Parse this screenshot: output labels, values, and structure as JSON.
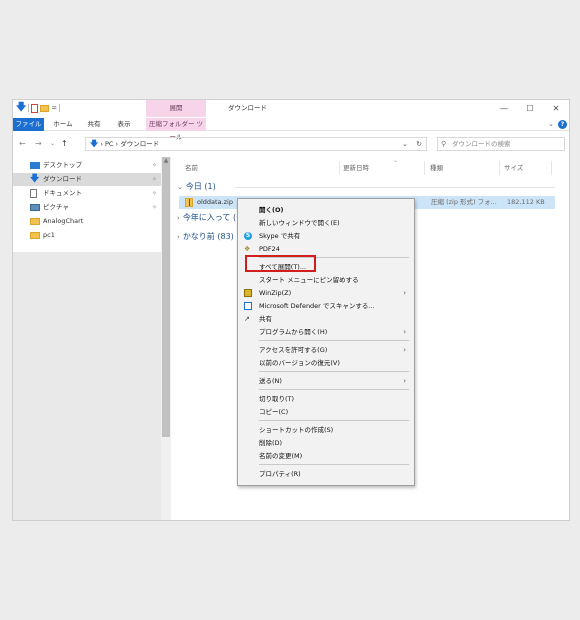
{
  "titlebar": {
    "context_tab_title": "展開",
    "window_title": "ダウンロード",
    "qa_eq": "=",
    "minimize": "—",
    "maximize": "☐",
    "close": "✕"
  },
  "ribbon": {
    "tabs": [
      "ファイル",
      "ホーム",
      "共有",
      "表示",
      "圧縮フォルダー ツール"
    ],
    "help": "?"
  },
  "address": {
    "path_pc": "PC",
    "path_sep": "›",
    "path_folder": "ダウンロード",
    "search_placeholder": "ダウンロードの検索"
  },
  "nav_pane": {
    "items": [
      {
        "label": "デスクトップ",
        "icon": "desktop-icon",
        "pinned": true
      },
      {
        "label": "ダウンロード",
        "icon": "download-icon",
        "pinned": true,
        "selected": true
      },
      {
        "label": "ドキュメント",
        "icon": "document-icon",
        "pinned": true
      },
      {
        "label": "ピクチャ",
        "icon": "picture-icon",
        "pinned": true
      },
      {
        "label": "AnalogChart",
        "icon": "folder-icon",
        "pinned": false
      },
      {
        "label": "pc1",
        "icon": "folder-icon",
        "pinned": false
      }
    ]
  },
  "columns": {
    "name": "名前",
    "modified": "更新日時",
    "type": "種類",
    "size": "サイズ"
  },
  "groups": {
    "today": "今日 (1)",
    "this_year": "今年に入って (",
    "long_ago": "かなり前 (83)"
  },
  "file": {
    "name": "olddata.zip",
    "type": "圧縮 (zip 形式) フォ...",
    "size": "182,112 KB"
  },
  "context_menu": {
    "open": "開く(O)",
    "open_new_window": "新しいウィンドウで開く(E)",
    "skype_share": "Skype で共有",
    "pdf24": "PDF24",
    "extract_all": "すべて展開(T)...",
    "pin_start": "スタート メニューにピン留めする",
    "winzip": "WinZip(Z)",
    "defender": "Microsoft Defender でスキャンする...",
    "share": "共有",
    "open_with": "プログラムから開く(H)",
    "give_access": "アクセスを許可する(G)",
    "restore_prev": "以前のバージョンの復元(V)",
    "send_to": "送る(N)",
    "cut": "切り取り(T)",
    "copy": "コピー(C)",
    "create_shortcut": "ショートカットの作成(S)",
    "delete": "削除(D)",
    "rename": "名前の変更(M)",
    "properties": "プロパティ(R)"
  },
  "colors": {
    "accent": "#1a6fd1",
    "context_tab": "#f7d4ea",
    "selection": "#cce4f7",
    "highlight_box": "#d11f1f"
  }
}
